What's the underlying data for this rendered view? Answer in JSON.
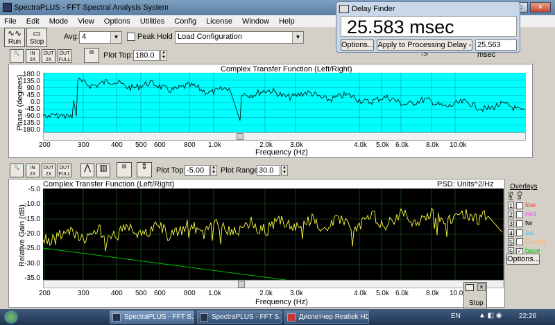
{
  "window": {
    "title": "SpectraPLUS - FFT Spectral Analysis System"
  },
  "menu": [
    "File",
    "Edit",
    "Mode",
    "View",
    "Options",
    "Utilities",
    "Config",
    "License",
    "Window",
    "Help"
  ],
  "toolbar": {
    "run_label": "Run",
    "stop_label": "Stop",
    "avg_label": "Avg:",
    "avg_value": "4",
    "peak_hold_label": "Peak Hold",
    "config_value": "Load Configuration"
  },
  "phase_panel": {
    "plot_top_label": "Plot Top:",
    "plot_top_value": "180.0",
    "buttons": [
      "IN\n2X",
      "OUT\n2X",
      "OUT\nFULL"
    ],
    "chart_title": "Complex Transfer Function (Left/Right)",
    "ylabel": "Phase (degrees)",
    "xlabel": "Frequency (Hz)",
    "yticks": [
      "180.0",
      "135.0",
      "90.0",
      "45.0",
      "0.0",
      "-45.0",
      "-90.0",
      "-135.0",
      "-180.0"
    ],
    "xticks": [
      "200",
      "300",
      "400",
      "500",
      "600",
      "800",
      "1.0k",
      "2.0k",
      "3.0k",
      "4.0k",
      "5.0k",
      "6.0k",
      "8.0k",
      "10.0k"
    ],
    "plot_color": "#00ffff"
  },
  "mag_panel": {
    "plot_top_label": "Plot Top:",
    "plot_top_value": "-5.00",
    "plot_range_label": "Plot Range:",
    "plot_range_value": "30.0",
    "chart_title": "Complex Transfer Function (Left/Right)",
    "psd_label": "PSD: Units^2/Hz",
    "ylabel": "Relative Gain (dB)",
    "xlabel": "Frequency (Hz)",
    "yticks": [
      "-5.0",
      "-10.0",
      "-15.0",
      "-20.0",
      "-25.0",
      "-30.0",
      "-35.0"
    ],
    "xticks": [
      "200",
      "300",
      "400",
      "500",
      "600",
      "800",
      "1.0k",
      "2.0k",
      "3.0k",
      "4.0k",
      "5.0k",
      "6.0k",
      "8.0k",
      "10.0k"
    ],
    "trace_color": "#ffff40",
    "ref_color": "#00c000"
  },
  "overlays": {
    "title": "Overlays",
    "col_labels": [
      "Sel",
      "On"
    ],
    "items": [
      {
        "num": "1",
        "label": "low",
        "checked": "",
        "color": "#ff4040"
      },
      {
        "num": "2",
        "label": "mid",
        "checked": "",
        "color": "#ff40ff"
      },
      {
        "num": "3",
        "label": "tw",
        "checked": "",
        "color": "#000000"
      },
      {
        "num": "4",
        "label": "sw",
        "checked": "",
        "color": "#40c0ff"
      },
      {
        "num": "5",
        "label": "Overla",
        "checked": "",
        "color": "#ffb070"
      },
      {
        "num": "6",
        "label": "base",
        "checked": "✓",
        "color": "#00c000"
      }
    ],
    "options_label": "Options..."
  },
  "delay_finder": {
    "title": "Delay Finder",
    "value": "25.583 msec",
    "options_label": "Options...",
    "apply_label": "Apply to Processing Delay -->",
    "applied_value": "25.563 msec"
  },
  "stop_window": {
    "label": "Stop"
  },
  "taskbar": {
    "tasks": [
      "SpectraPLUS - FFT S...",
      "SpectraPLUS - FFT S...",
      "Диспетчер Realtek HD"
    ],
    "lang": "EN",
    "clock": "22:26"
  }
}
